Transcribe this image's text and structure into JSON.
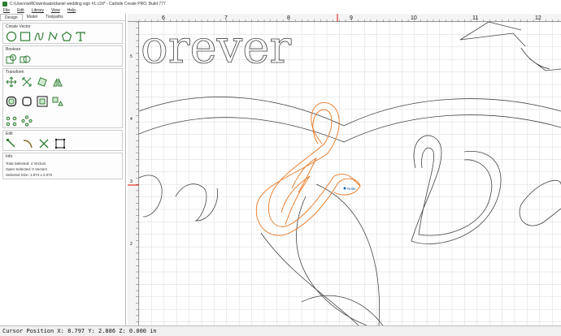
{
  "window": {
    "title": "C:\\Users\\will\\Downloads\\daniel wedding sign #1.c2d* - Carbide Create PRO, Build 777"
  },
  "menu": {
    "items": [
      {
        "label": "File"
      },
      {
        "label": "Edit"
      },
      {
        "label": "Library"
      },
      {
        "label": "View"
      },
      {
        "label": "Help"
      }
    ]
  },
  "tabs": [
    {
      "label": "Design",
      "active": true
    },
    {
      "label": "Model",
      "active": false
    },
    {
      "label": "Toolpaths",
      "active": false
    }
  ],
  "panel": {
    "create_vector": {
      "title": "Create Vector",
      "tools": [
        "circle-tool-icon",
        "rectangle-tool-icon",
        "curve-tool-icon",
        "polyline-tool-icon",
        "polygon-tool-icon",
        "text-tool-icon"
      ]
    },
    "boolean": {
      "title": "Boolean",
      "tools": [
        "combine-icon",
        "subtract-icon"
      ]
    },
    "transform": {
      "title": "Transform",
      "tools": [
        "move-icon",
        "scale-icon",
        "rotate-icon",
        "mirror-icon",
        "offset-icon",
        "fillet-icon",
        "align-icon",
        "group-icon",
        "weld-icon",
        "array-icon",
        "circular-array-icon",
        "tiling-icon"
      ]
    },
    "edit": {
      "title": "Edit",
      "tools": [
        "node-edit-icon",
        "bezier-icon",
        "trim-icon",
        "boundary-icon"
      ]
    },
    "info": {
      "title": "Info",
      "total_selected": "Total Selected: 4 Vectors",
      "open_selected": "Open Selected: 0 Vectors",
      "selected_size": "Selected Size: 1.974 x 2.072"
    }
  },
  "ruler": {
    "h_labels": [
      "6",
      "7",
      "8",
      "9",
      "10",
      "11",
      "12"
    ],
    "v_labels": [
      "5",
      "4",
      "3",
      "2"
    ]
  },
  "canvas": {
    "text_forever": "orever",
    "node_label": "Node",
    "selection_color": "#e87722"
  },
  "status": {
    "cursor": "Cursor Position X: 8.797 Y: 2.886 Z: 0.000 in"
  },
  "colors": {
    "accent": "#2e7d32",
    "grid": "#d9d9d9",
    "marker": "#e53935"
  }
}
